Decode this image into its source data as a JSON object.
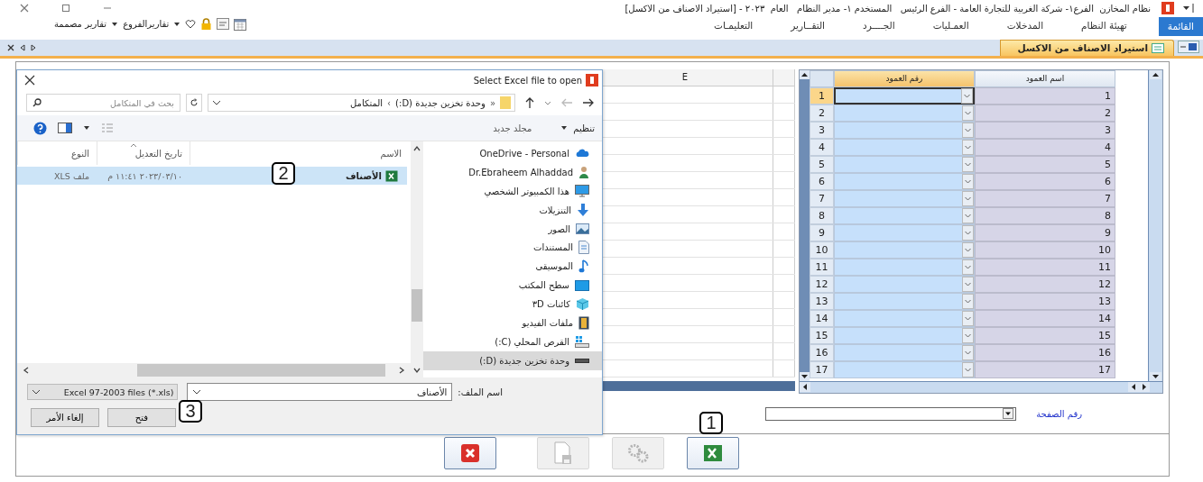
{
  "window": {
    "title": "نظام المخازن  الفرع١- شركة الغربية للتجارة العامة - الفرع الرئيس   المستخدم ١- مدير النظام   العام  ٢٠٢٣ - [استيراد الاصناف من الاكسل]"
  },
  "menu": [
    {
      "label": "القائمة",
      "selected": true
    },
    {
      "label": "تهيئة النظام",
      "selected": false
    },
    {
      "label": "المدخلات",
      "selected": false
    },
    {
      "label": "العمـليات",
      "selected": false
    },
    {
      "label": "الجــــرد",
      "selected": false
    },
    {
      "label": "التقــارير",
      "selected": false
    },
    {
      "label": "التعليمـات",
      "selected": false
    }
  ],
  "toolbar": [
    {
      "label": "تقاريرالفروع"
    },
    {
      "label": "تقارير مصممة"
    }
  ],
  "doc_tabs": [
    {
      "label": "استيراد الاصناف من الاكسل",
      "selected": true
    }
  ],
  "sheet": {
    "columns": [
      "E"
    ]
  },
  "mapping_grid": {
    "columns": [
      "اسم العمود",
      "رقم العمود"
    ],
    "rows": [
      {
        "number": "1",
        "name": "1",
        "selected": true
      },
      {
        "number": "2",
        "name": "2",
        "selected": false
      },
      {
        "number": "3",
        "name": "3",
        "selected": false
      },
      {
        "number": "4",
        "name": "4",
        "selected": false
      },
      {
        "number": "5",
        "name": "5",
        "selected": false
      },
      {
        "number": "6",
        "name": "6",
        "selected": false
      },
      {
        "number": "7",
        "name": "7",
        "selected": false
      },
      {
        "number": "8",
        "name": "8",
        "selected": false
      },
      {
        "number": "9",
        "name": "9",
        "selected": false
      },
      {
        "number": "10",
        "name": "10",
        "selected": false
      },
      {
        "number": "11",
        "name": "11",
        "selected": false
      },
      {
        "number": "12",
        "name": "12",
        "selected": false
      },
      {
        "number": "13",
        "name": "13",
        "selected": false
      },
      {
        "number": "14",
        "name": "14",
        "selected": false
      },
      {
        "number": "15",
        "name": "15",
        "selected": false
      },
      {
        "number": "16",
        "name": "16",
        "selected": false
      },
      {
        "number": "17",
        "name": "17",
        "selected": false
      }
    ]
  },
  "page_field": {
    "label": "رقم الصفحة"
  },
  "action_buttons": [
    {
      "kind": "close",
      "disabled": false
    },
    {
      "kind": "save",
      "disabled": true
    },
    {
      "kind": "settings",
      "disabled": true
    },
    {
      "kind": "excel",
      "disabled": false
    }
  ],
  "dialog": {
    "title": "Select Excel file to open",
    "path": [
      "«",
      "وحدة تخزين جديدة (D:)",
      "›",
      "المتكامل"
    ],
    "search": {
      "placeholder": "بحث في المتكامل"
    },
    "organize": "تنظيم",
    "new_folder": "مجلد جديد",
    "nav": [
      {
        "kind": "cloud",
        "label": "OneDrive - Personal",
        "selected": false
      },
      {
        "kind": "user",
        "label": "Dr.Ebraheem Alhaddad",
        "selected": false
      },
      {
        "kind": "computer",
        "label": "هذا الكمبيوتر الشخصي",
        "selected": false
      },
      {
        "kind": "download",
        "label": "التنزيلات",
        "selected": false
      },
      {
        "kind": "pictures",
        "label": "الصور",
        "selected": false
      },
      {
        "kind": "documents",
        "label": "المستندات",
        "selected": false
      },
      {
        "kind": "music",
        "label": "الموسيقى",
        "selected": false
      },
      {
        "kind": "desktop",
        "label": "سطح المكتب",
        "selected": false
      },
      {
        "kind": "objects",
        "label": "كائنات ٣D",
        "selected": false
      },
      {
        "kind": "videos",
        "label": "ملفات الفيديو",
        "selected": false
      },
      {
        "kind": "drive_c",
        "label": "القرص المحلي (C:)",
        "selected": false
      },
      {
        "kind": "drive",
        "label": "وحدة تخزين جديدة (D:)",
        "selected": true
      }
    ],
    "columns": [
      "الاسم",
      "تاريخ التعديل",
      "النوع"
    ],
    "files": [
      {
        "name": "الأصناف",
        "modified": "٢٠٢٣/٠٣/١٠ ١١:٤١ م",
        "type": "ملف XLS",
        "selected": true
      }
    ],
    "filename_label": "اسم الملف:",
    "filename": "الأصناف",
    "filter": "Excel 97-2003 files (*.xls)",
    "buttons": [
      "فتح",
      "إلغاء الأمر"
    ]
  },
  "callouts": [
    "1",
    "2",
    "3"
  ]
}
